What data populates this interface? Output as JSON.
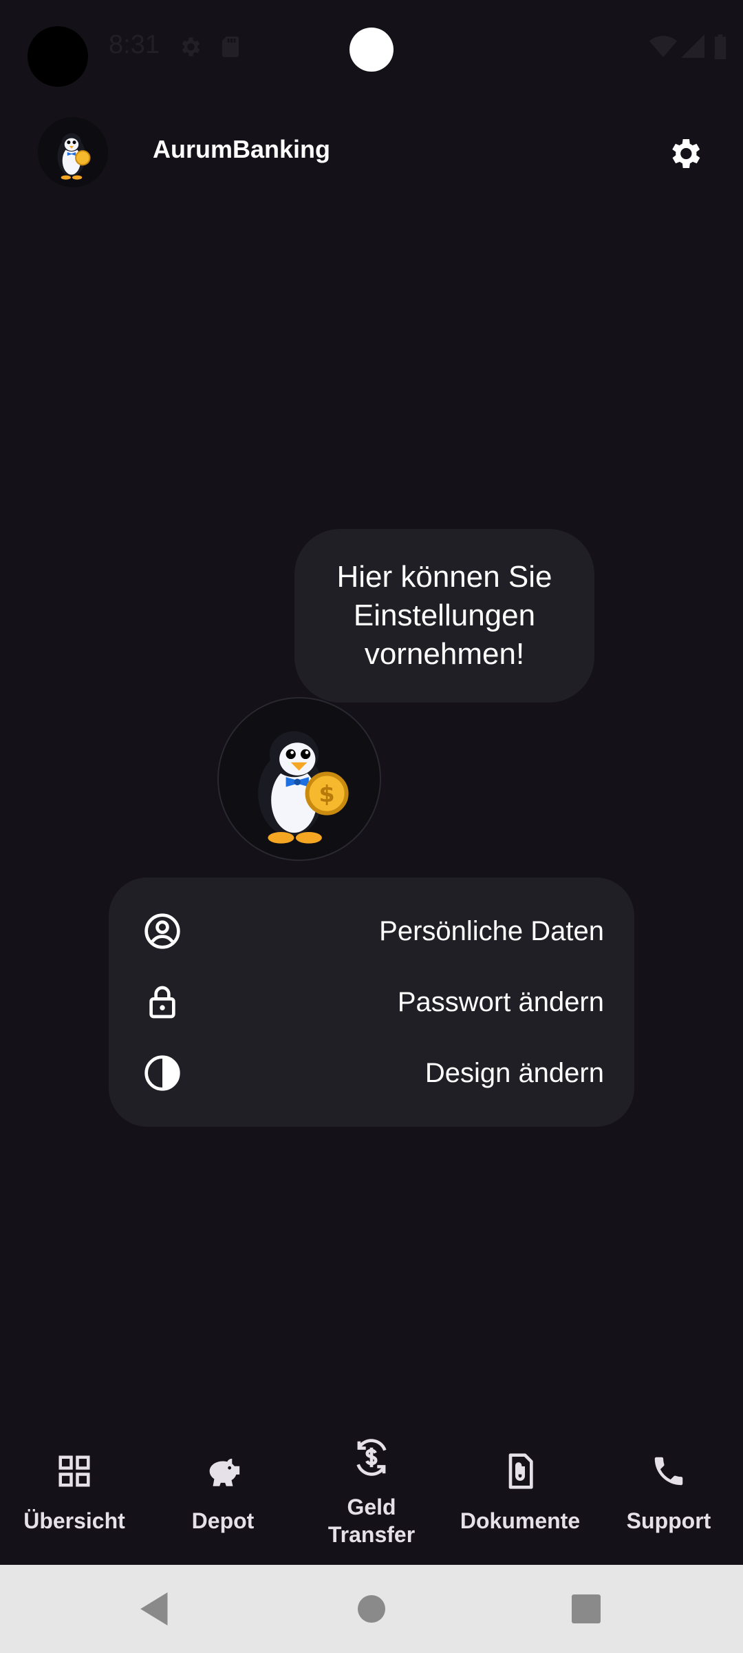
{
  "status_bar": {
    "time": "8:31"
  },
  "header": {
    "app_title": "AurumBanking",
    "settings_icon": "gear-icon"
  },
  "bubble": {
    "text": "Hier können Sie Einstellungen vornehmen!"
  },
  "menu": {
    "items": [
      {
        "label": "Persönliche Daten",
        "icon": "account-circle-icon"
      },
      {
        "label": "Passwort ändern",
        "icon": "lock-icon"
      },
      {
        "label": "Design ändern",
        "icon": "contrast-icon"
      }
    ]
  },
  "bottom_nav": {
    "items": [
      {
        "label": "Übersicht",
        "icon": "grid-icon"
      },
      {
        "label": "Depot",
        "icon": "piggy-bank-icon"
      },
      {
        "label_line1": "Geld",
        "label_line2": "Transfer",
        "icon": "currency-exchange-icon"
      },
      {
        "label": "Dokumente",
        "icon": "attachment-file-icon"
      },
      {
        "label": "Support",
        "icon": "phone-icon"
      }
    ]
  },
  "colors": {
    "background": "#141218",
    "surface": "#211f26",
    "text": "#ffffff",
    "nav_text": "#e6e0e9",
    "system_nav_bg": "#e6e6e6"
  }
}
